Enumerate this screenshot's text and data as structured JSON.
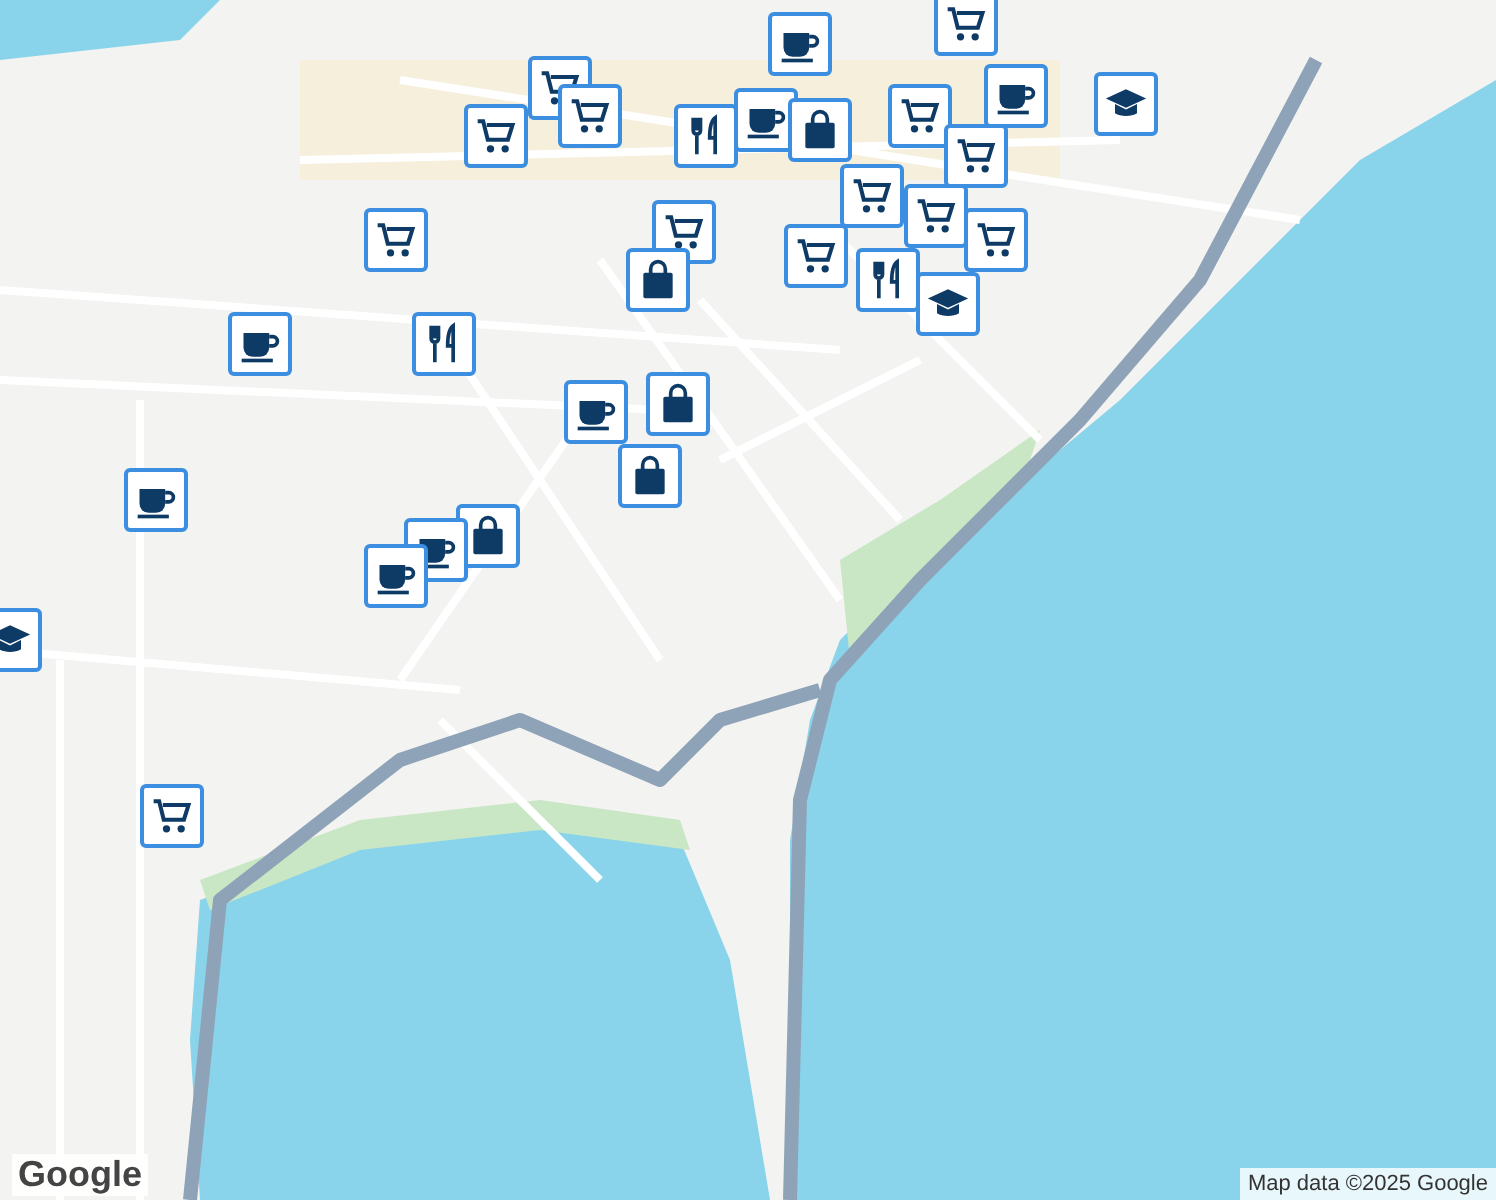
{
  "map": {
    "markers": [
      {
        "kind": "cart"
      },
      {
        "kind": "coffee"
      },
      {
        "kind": "cart"
      },
      {
        "kind": "cart"
      },
      {
        "kind": "cart"
      },
      {
        "kind": "fork"
      },
      {
        "kind": "coffee"
      },
      {
        "kind": "bag"
      },
      {
        "kind": "cart"
      },
      {
        "kind": "coffee"
      },
      {
        "kind": "school"
      },
      {
        "kind": "cart"
      },
      {
        "kind": "cart"
      },
      {
        "kind": "cart"
      },
      {
        "kind": "cart"
      },
      {
        "kind": "cart"
      },
      {
        "kind": "fork"
      },
      {
        "kind": "school"
      },
      {
        "kind": "cart"
      },
      {
        "kind": "bag"
      },
      {
        "kind": "cart"
      },
      {
        "kind": "coffee"
      },
      {
        "kind": "fork"
      },
      {
        "kind": "coffee"
      },
      {
        "kind": "bag"
      },
      {
        "kind": "bag"
      },
      {
        "kind": "coffee"
      },
      {
        "kind": "bag"
      },
      {
        "kind": "coffee"
      },
      {
        "kind": "coffee"
      },
      {
        "kind": "cart"
      },
      {
        "kind": "school"
      }
    ]
  },
  "attribution": "Map data ©2025 Google",
  "logo": "Google"
}
